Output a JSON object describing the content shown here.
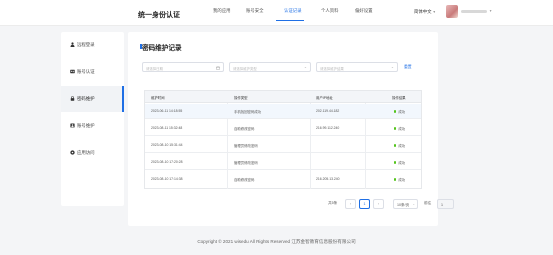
{
  "header": {
    "brand": "统一身份认证",
    "nav": [
      {
        "label": "我的应用"
      },
      {
        "label": "账号安全"
      },
      {
        "label": "认证记录"
      },
      {
        "label": "个人资料"
      },
      {
        "label": "偏好设置"
      }
    ],
    "active_nav": "认证记录",
    "language": "简体中文",
    "accent": "#1f6fe5"
  },
  "sidebar": {
    "items": [
      {
        "label": "远程登录",
        "icon": "user-icon"
      },
      {
        "label": "账号认证",
        "icon": "id-card-icon"
      },
      {
        "label": "密码维护",
        "icon": "lock-icon"
      },
      {
        "label": "账号维护",
        "icon": "account-icon"
      },
      {
        "label": "应用访问",
        "icon": "app-icon"
      }
    ],
    "active": "密码维护"
  },
  "main": {
    "title": "密码维护记录",
    "filters": {
      "date_placeholder": "请选择日期",
      "type_placeholder": "请选择维护类型",
      "result_placeholder": "请选择维护结果",
      "reset_label": "重置"
    },
    "table": {
      "columns": [
        "维护时间",
        "操作类型",
        "用户IP地址",
        "操作结果"
      ],
      "rows": [
        {
          "time": "2023-06-11 14:18:55",
          "type": "手机找回密码成功",
          "ip": "202.119.44.182",
          "result": "成功"
        },
        {
          "time": "2023-08-11 15:32:48",
          "type": "自助修改密码",
          "ip": "216.99.112.240",
          "result": "成功"
        },
        {
          "time": "2023-08-10 15:31:44",
          "type": "管理员修改密码",
          "ip": "",
          "result": "成功"
        },
        {
          "time": "2023-08-10 17:20:28",
          "type": "管理员修改密码",
          "ip": "",
          "result": "成功"
        },
        {
          "time": "2023-08-10 17:14:38",
          "type": "自助修改密码",
          "ip": "216.205.13.240",
          "result": "成功"
        }
      ],
      "status_color": "#52c41a"
    },
    "pagination": {
      "total_label": "共5条",
      "prev": "‹",
      "current_page": "1",
      "next": "›",
      "page_size": "10条/页",
      "jump_label": "前往",
      "jump_value": "1"
    }
  },
  "footer": {
    "copyright": "Copyright © 2021 wisedu All Rights Reserved 江苏金智教育信息股份有限公司"
  }
}
